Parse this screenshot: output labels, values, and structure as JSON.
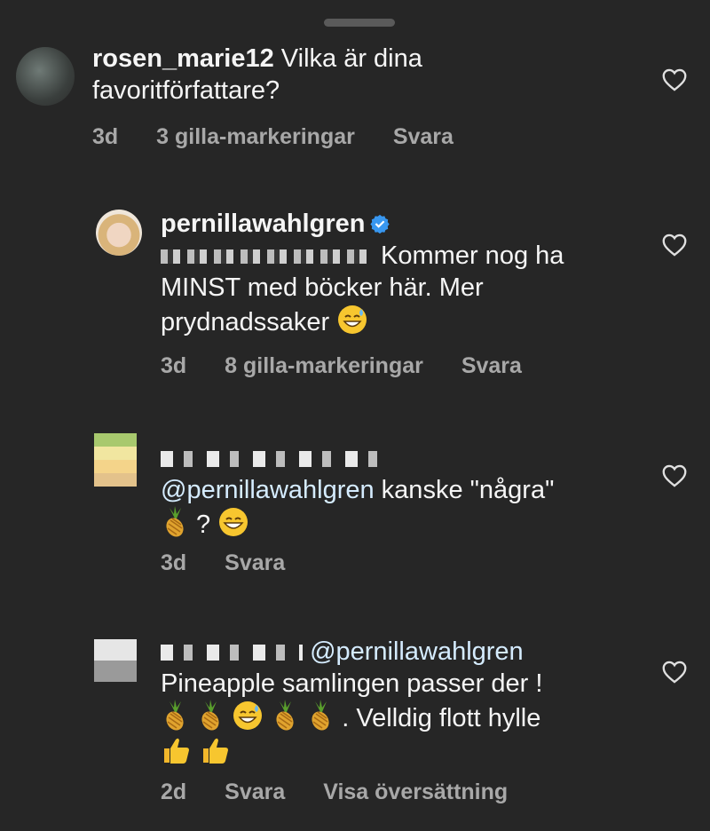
{
  "comments": [
    {
      "username": "rosen_marie12",
      "text_line1": " Vilka är dina",
      "text_line2": "favoritförfattare?",
      "time": "3d",
      "likes": "3 gilla-markeringar",
      "reply": "Svara"
    },
    {
      "username": "pernillawahlgren",
      "verified": true,
      "text_line1": " Kommer nog ha",
      "text_line2": "MINST med böcker här. Mer",
      "text_line3": "prydnadssaker",
      "time": "3d",
      "likes": "8 gilla-markeringar",
      "reply": "Svara"
    },
    {
      "mention": "@pernillawahlgren",
      "text_line1": " kanske \"några\"",
      "text_line2": " ? ",
      "time": "3d",
      "reply": "Svara"
    },
    {
      "mention": "@pernillawahlgren",
      "text_line2": "Pineapple samlingen passer der !",
      "text_line3": " . Velldig flott hylle",
      "time": "2d",
      "reply": "Svara",
      "translate": "Visa översättning"
    }
  ],
  "icons": {
    "like": "heart-outline-icon",
    "verified": "verified-badge-icon",
    "pineapple": "pineapple-emoji",
    "sweat_smile": "sweat-smile-emoji",
    "grin": "grin-emoji",
    "thumbs_up": "thumbs-up-emoji"
  },
  "colors": {
    "background": "#262626",
    "text": "#f5f5f5",
    "secondary": "#a8a8a8",
    "verified": "#3897f0"
  }
}
